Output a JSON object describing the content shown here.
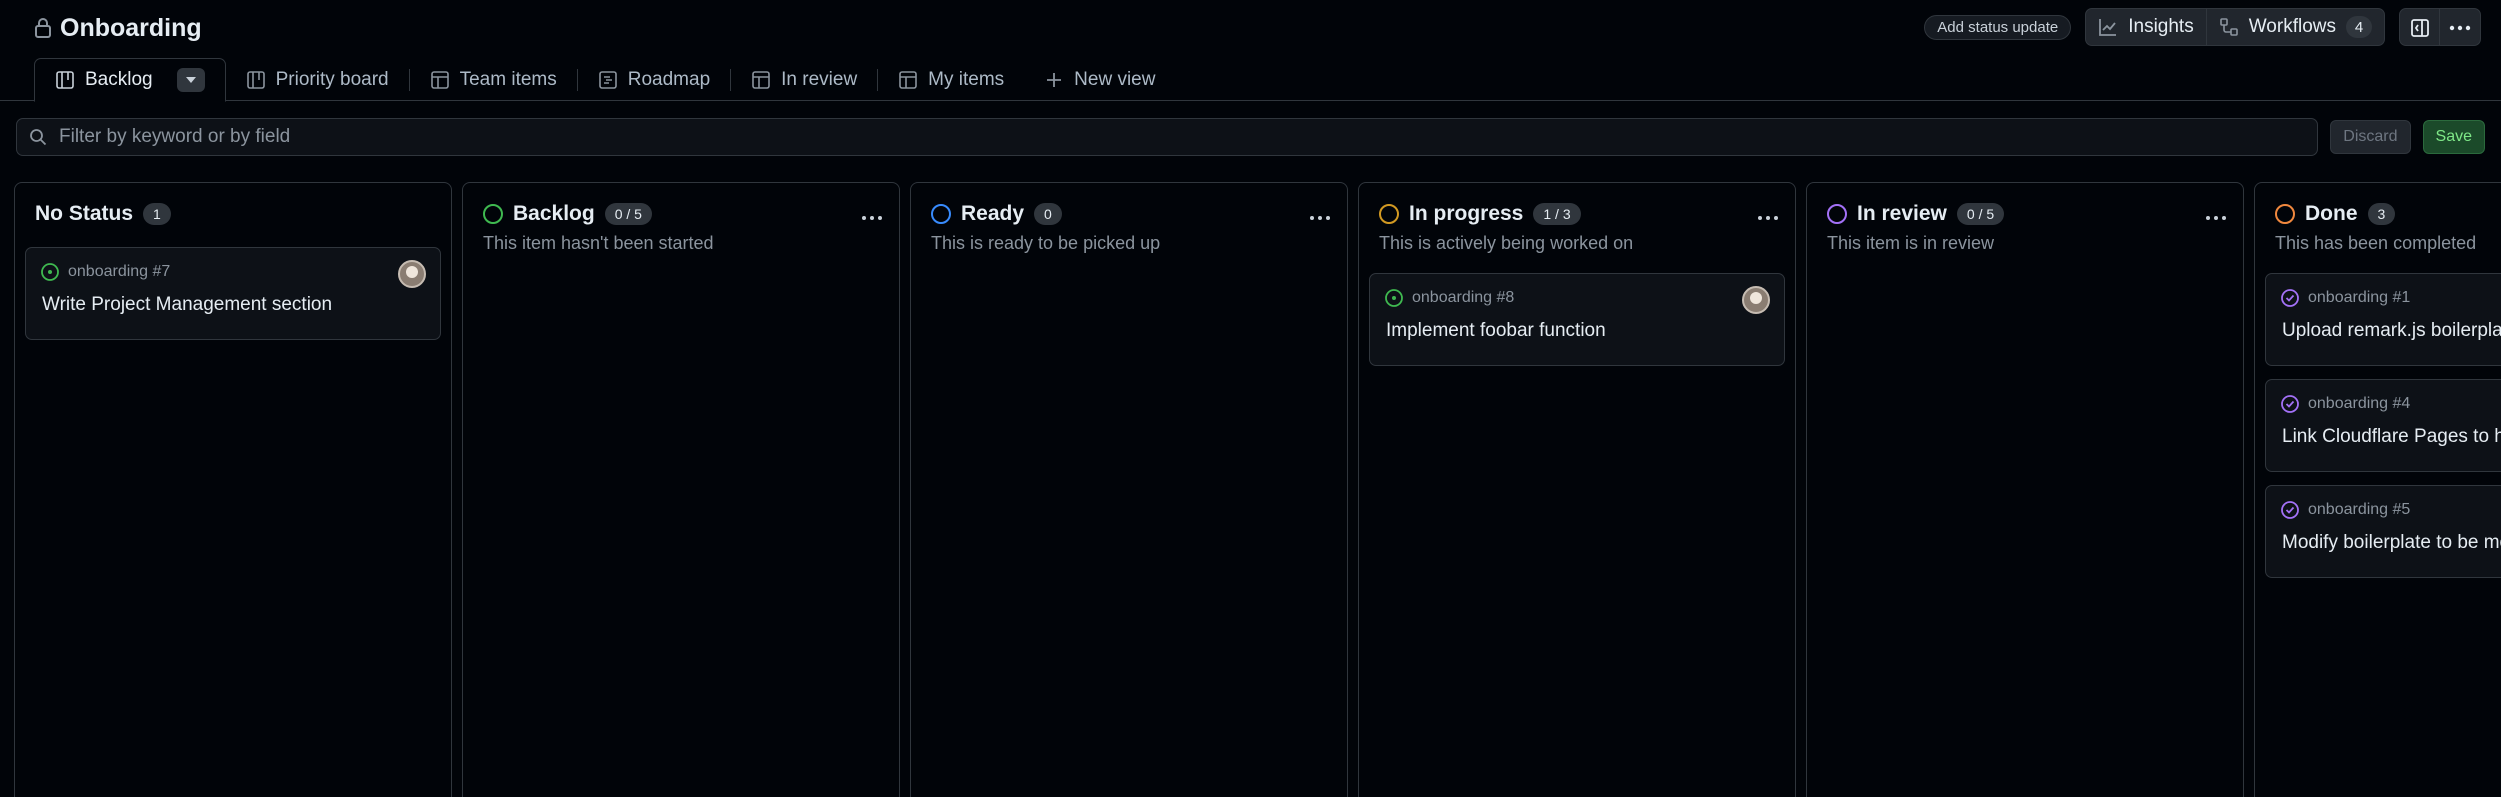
{
  "header": {
    "title": "Onboarding",
    "status_update_label": "Add status update",
    "insights_label": "Insights",
    "workflows_label": "Workflows",
    "workflows_count": "4"
  },
  "tabs": [
    {
      "label": "Backlog",
      "icon": "board-icon"
    },
    {
      "label": "Priority board",
      "icon": "board-icon"
    },
    {
      "label": "Team items",
      "icon": "table-icon"
    },
    {
      "label": "Roadmap",
      "icon": "roadmap-icon"
    },
    {
      "label": "In review",
      "icon": "table-icon"
    },
    {
      "label": "My items",
      "icon": "table-icon"
    },
    {
      "label": "New view",
      "icon": "plus-icon"
    }
  ],
  "filter": {
    "placeholder": "Filter by keyword or by field",
    "discard_label": "Discard",
    "save_label": "Save"
  },
  "columns": [
    {
      "title": "No Status",
      "count": "1",
      "desc": "",
      "color": "",
      "cards": [
        {
          "meta": "onboarding #7",
          "title": "Write Project Management section",
          "state": "open",
          "avatar": true
        }
      ]
    },
    {
      "title": "Backlog",
      "count": "0 / 5",
      "desc": "This item hasn't been started",
      "color": "#3fb950",
      "cards": []
    },
    {
      "title": "Ready",
      "count": "0",
      "desc": "This is ready to be picked up",
      "color": "#388bfd",
      "cards": []
    },
    {
      "title": "In progress",
      "count": "1 / 3",
      "desc": "This is actively being worked on",
      "color": "#d29922",
      "cards": [
        {
          "meta": "onboarding #8",
          "title": "Implement foobar function",
          "state": "open",
          "avatar": true
        }
      ]
    },
    {
      "title": "In review",
      "count": "0 / 5",
      "desc": "This item is in review",
      "color": "#a371f7",
      "cards": []
    },
    {
      "title": "Done",
      "count": "3",
      "desc": "This has been completed",
      "color": "#f0883e",
      "cards": [
        {
          "meta": "onboarding #1",
          "title": "Upload remark.js boilerplate",
          "state": "closed",
          "avatar": false
        },
        {
          "meta": "onboarding #4",
          "title": "Link Cloudflare Pages to host",
          "state": "closed",
          "avatar": false
        },
        {
          "meta": "onboarding #5",
          "title": "Modify boilerplate to be more",
          "state": "closed",
          "avatar": false
        }
      ]
    }
  ]
}
